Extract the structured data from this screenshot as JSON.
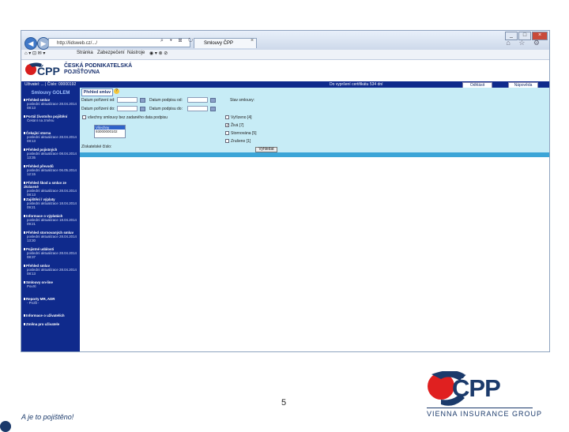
{
  "browser": {
    "address": "http://lidsweb.cz/.../",
    "tab_title": "Smlouvy ČPP",
    "menu": [
      "Stránka",
      "Zabezpečení",
      "Nástroje"
    ],
    "colors": {
      "header_blue": "#0f2a8c",
      "panel_bg": "#c7ecf6",
      "result_bar": "#3ca5d7"
    }
  },
  "site": {
    "brand_line1": "ČESKÁ PODNIKATELSKÁ",
    "brand_line2": "POJIŠŤOVNA",
    "status_left": "Uživatel: ... | Číslo: 00000192",
    "status_mid": "Do vypršení certifikátu 534 dní",
    "logout": "Odhlásit",
    "help": "Nápověda"
  },
  "sidebar": {
    "title": "Smlouvy GOLEM",
    "items": [
      {
        "title": "Přehled smluv",
        "detail": "poslední aktualizace 28.04.2014 08:13"
      },
      {
        "title": "Portál životního pojištění",
        "detail": "Čekání na změnu"
      },
      {
        "title": "Čekající storna",
        "detail": "poslední aktualizace 28.04.2014 08:13"
      },
      {
        "title": "Přehled pojistných",
        "detail": "poslední aktualizace 08.04.2014 13:35"
      },
      {
        "title": "Přehled převodů",
        "detail": "poslední aktualizace 06.05.2014 12:15"
      },
      {
        "title": "Přehled škod a smluv ze zkrácené",
        "detail": "poslední aktualizace 28.04.2014 08:13"
      },
      {
        "title": "Zajištění / výplaty",
        "detail": "poslední aktualizace 18.04.2014 09:21"
      },
      {
        "title": "Informace o výplatách",
        "detail": "poslední aktualizace 18.04.2014 09:21"
      },
      {
        "title": "Přehled stornovaných smluv",
        "detail": "poslední aktualizace 28.04.2014 13:30"
      },
      {
        "title": "Pojistné události",
        "detail": "poslední aktualizace 28.04.2014 08:37"
      },
      {
        "title": "Přehled smluv",
        "detail": "poslední aktualizace 28.04.2014 08:13"
      },
      {
        "title": "Smlouvy on-line",
        "detail": "PovXl"
      },
      {
        "title": "Reporty MR, ADR",
        "detail": "- Profil -"
      },
      {
        "title": "Informace o uživatelích",
        "detail": ""
      },
      {
        "title": "Změna pro uživatele",
        "detail": ""
      }
    ]
  },
  "form": {
    "tab": "Přehled smluv",
    "date_created_from": "Datum pořízení od:",
    "date_created_to": "Datum pořízení do:",
    "date_signed_from": "Datum podpisu od:",
    "date_signed_to": "Datum podpisu do:",
    "contract_state": "Stav smlouvy:",
    "all_contracts_label": "všechny smlouvy bez zadaného data podpisu",
    "intermediary_label": "Získatelské číslo:",
    "list_options": [
      "Všechny",
      "93000000102"
    ],
    "states": [
      {
        "label": "Vyřízeno [4]",
        "checked": false
      },
      {
        "label": "Živá [7]",
        "checked": true
      },
      {
        "label": "Stornována [5]",
        "checked": false
      },
      {
        "label": "Zrušeno [1]",
        "checked": false
      }
    ],
    "search_button": "Vyhledat"
  },
  "slide": {
    "page_number": "5",
    "tagline": "A je to pojištěno!",
    "logo_text": "ČPP",
    "group_text": "VIENNA INSURANCE GROUP"
  }
}
